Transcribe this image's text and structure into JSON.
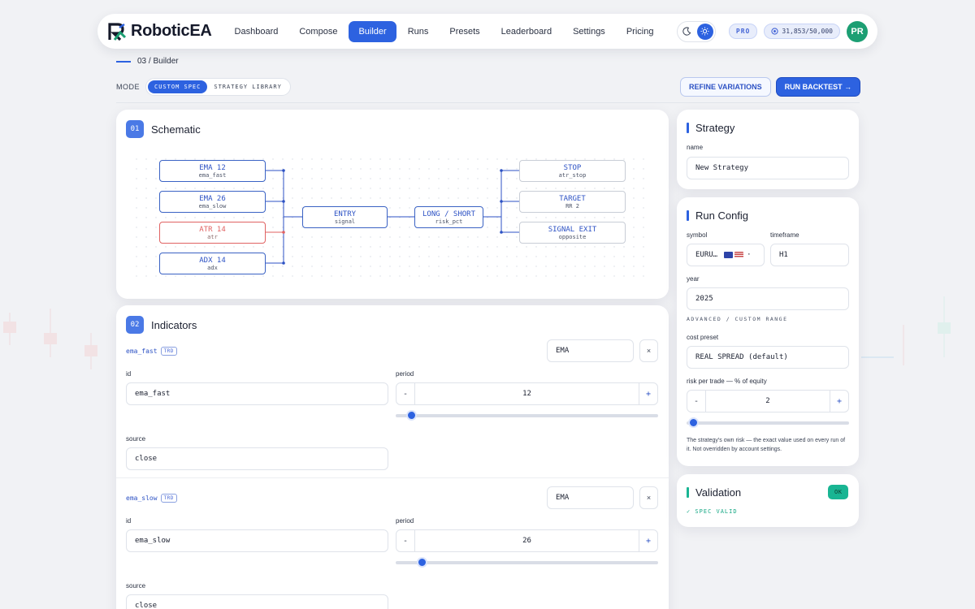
{
  "app": {
    "logo_text": "RoboticEA"
  },
  "nav": {
    "links": [
      "Dashboard",
      "Compose",
      "Builder",
      "Runs",
      "Presets",
      "Leaderboard",
      "Settings",
      "Pricing"
    ],
    "active": "Builder",
    "pro_badge": "PRO",
    "credits": "31,853/50,000",
    "avatar_initials": "PR"
  },
  "breadcrumb": "03 / Builder",
  "mode": {
    "label": "MODE",
    "options": [
      "CUSTOM SPEC",
      "STRATEGY LIBRARY"
    ],
    "selected": "CUSTOM SPEC"
  },
  "actions": {
    "refine": "REFINE VARIATIONS",
    "run": "RUN BACKTEST →"
  },
  "schematic": {
    "number": "01",
    "title": "Schematic",
    "inputs": [
      {
        "label": "EMA 12",
        "sub": "ema_fast"
      },
      {
        "label": "EMA 26",
        "sub": "ema_slow"
      },
      {
        "label": "ATR 14",
        "sub": "atr"
      },
      {
        "label": "ADX 14",
        "sub": "adx"
      }
    ],
    "entry": {
      "label": "ENTRY",
      "sub": "signal"
    },
    "direction": {
      "label": "LONG / SHORT",
      "sub": "risk_pct"
    },
    "outputs": [
      {
        "label": "STOP",
        "sub": "atr_stop"
      },
      {
        "label": "TARGET",
        "sub": "RR 2"
      },
      {
        "label": "SIGNAL EXIT",
        "sub": "opposite"
      }
    ]
  },
  "indicators": {
    "number": "02",
    "title": "Indicators",
    "items": [
      {
        "name": "ema_fast",
        "tag": "TRD",
        "type": "EMA",
        "remove": "×",
        "id_label": "id",
        "id": "ema_fast",
        "period_label": "period",
        "period": "12",
        "period_fraction": 0.06,
        "source_label": "source",
        "source": "close"
      },
      {
        "name": "ema_slow",
        "tag": "TRD",
        "type": "EMA",
        "remove": "×",
        "id_label": "id",
        "id": "ema_slow",
        "period_label": "period",
        "period": "26",
        "period_fraction": 0.1,
        "source_label": "source",
        "source": "close"
      }
    ],
    "minus": "-",
    "plus": "+"
  },
  "strategy": {
    "title": "Strategy",
    "name_label": "name",
    "name": "New Strategy"
  },
  "run_config": {
    "title": "Run Config",
    "symbol_label": "symbol",
    "symbol": "EURU…",
    "symbol_caret": "·",
    "timeframe_label": "timeframe",
    "timeframe": "H1",
    "year_label": "year",
    "year": "2025",
    "advanced": "ADVANCED / CUSTOM RANGE",
    "cost_label": "cost preset",
    "cost": "REAL SPREAD (default)",
    "risk_label": "risk per trade — % of equity",
    "risk": "2",
    "risk_fraction": 0.04,
    "help": "The strategy's own risk — the exact value used on every run of it. Not overridden by account settings.",
    "minus": "-",
    "plus": "+"
  },
  "validation": {
    "title": "Validation",
    "badge": "OK",
    "status": "✓ SPEC VALID"
  },
  "colors": {
    "accent": "#2d62e0",
    "ok": "#19b593",
    "alert": "#e06262"
  }
}
